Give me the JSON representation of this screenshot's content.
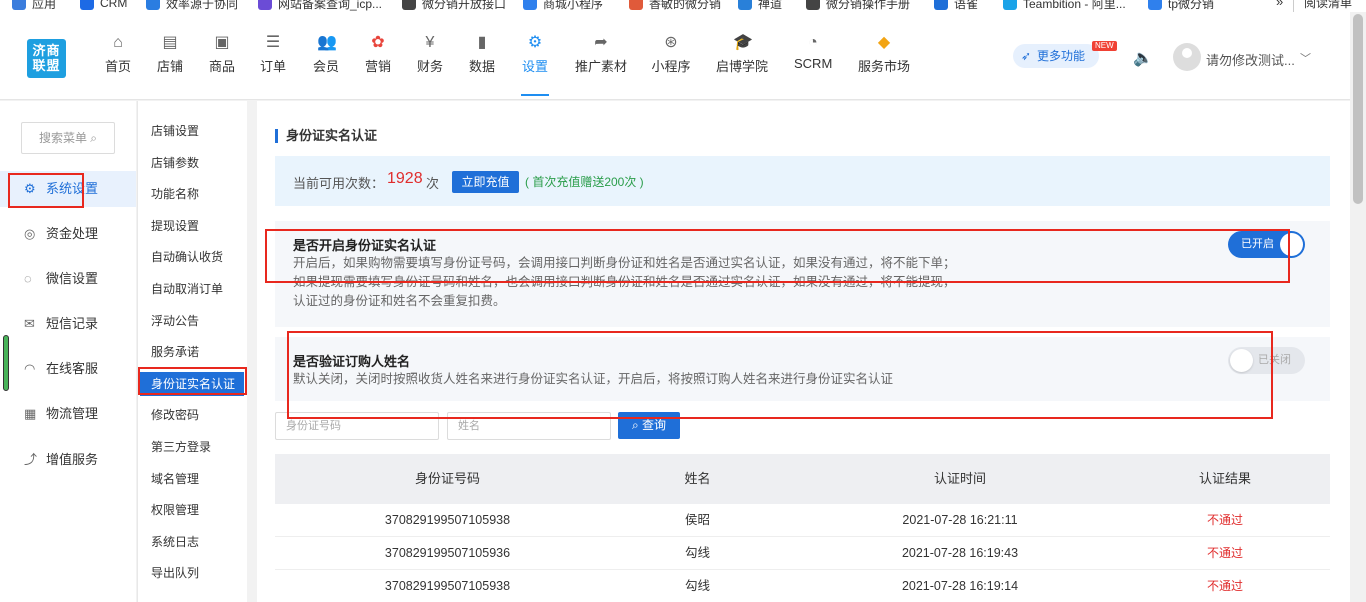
{
  "bookmarks": [
    {
      "label": "应用",
      "color": "#3b7ddd"
    },
    {
      "label": "CRM",
      "color": "#1d6ae5"
    },
    {
      "label": "效率源于协同",
      "color": "#2a7de1"
    },
    {
      "label": "网站备案查询_icp...",
      "color": "#6b4cd6"
    },
    {
      "label": "微分销开放接口",
      "color": "#444444"
    },
    {
      "label": "商城小程序",
      "color": "#2f80ed"
    },
    {
      "label": "香敏的微分销",
      "color": "#e05a3a"
    },
    {
      "label": "禅道",
      "color": "#2980d9"
    },
    {
      "label": "微分销操作手册",
      "color": "#444444"
    },
    {
      "label": "语雀",
      "color": "#1f6fd8"
    },
    {
      "label": "Teambition - 阿里...",
      "color": "#1aa3e8"
    },
    {
      "label": "tp微分销",
      "color": "#2f80ed"
    }
  ],
  "bookmarks_more": "»",
  "reading_list": "阅读清单",
  "logo_text": "济商联盟",
  "nav": [
    {
      "label": "首页",
      "icon": "home-icon",
      "glyph": "⌂"
    },
    {
      "label": "店铺",
      "icon": "shop-icon",
      "glyph": "▤"
    },
    {
      "label": "商品",
      "icon": "goods-icon",
      "glyph": "▣"
    },
    {
      "label": "订单",
      "icon": "order-icon",
      "glyph": "☰"
    },
    {
      "label": "会员",
      "icon": "member-icon",
      "glyph": "👥"
    },
    {
      "label": "营销",
      "icon": "marketing-icon",
      "glyph": "✿"
    },
    {
      "label": "财务",
      "icon": "finance-icon",
      "glyph": "¥"
    },
    {
      "label": "数据",
      "icon": "data-icon",
      "glyph": "▮"
    },
    {
      "label": "设置",
      "icon": "settings-icon",
      "glyph": "⚙"
    },
    {
      "label": "推广素材",
      "icon": "share-icon",
      "glyph": "➦"
    },
    {
      "label": "小程序",
      "icon": "miniapp-icon",
      "glyph": "⊛"
    },
    {
      "label": "启博学院",
      "icon": "academy-icon",
      "glyph": "🎓"
    },
    {
      "label": "SCRM",
      "icon": "scrm-icon",
      "glyph": "◔"
    },
    {
      "label": "服务市场",
      "icon": "market-icon",
      "glyph": "◆"
    }
  ],
  "more_functions": "更多功能",
  "new_badge": "NEW",
  "user_name": "请勿修改测试...",
  "side1": {
    "search": "搜索菜单 ⌕",
    "items": [
      {
        "label": "系统设置",
        "icon": "gear-icon",
        "glyph": "⚙"
      },
      {
        "label": "资金处理",
        "icon": "money-icon",
        "glyph": "◎"
      },
      {
        "label": "微信设置",
        "icon": "wechat-icon",
        "glyph": "◌"
      },
      {
        "label": "短信记录",
        "icon": "sms-icon",
        "glyph": "✉"
      },
      {
        "label": "在线客服",
        "icon": "headset-icon",
        "glyph": "◠"
      },
      {
        "label": "物流管理",
        "icon": "logistics-icon",
        "glyph": "▦"
      },
      {
        "label": "增值服务",
        "icon": "chart-icon",
        "glyph": "⤴"
      }
    ]
  },
  "side2": {
    "items": [
      "店铺设置",
      "店铺参数",
      "功能名称",
      "提现设置",
      "自动确认收货",
      "自动取消订单",
      "浮动公告",
      "服务承诺",
      "身份证实名认证",
      "修改密码",
      "第三方登录",
      "域名管理",
      "权限管理",
      "系统日志",
      "导出队列"
    ]
  },
  "main": {
    "title": "身份证实名认证",
    "quota_label": "当前可用次数：",
    "quota_value": "1928",
    "quota_unit": "次",
    "recharge_button": "立即充值",
    "gift_note": "( 首次充值赠送200次 )",
    "setting1": {
      "title": "是否开启身份证实名认证",
      "desc1": "开启后，如果购物需要填写身份证号码，会调用接口判断身份证和姓名是否通过实名认证，如果没有通过，将不能下单；",
      "desc2": "如果提现需要填写身份证号码和姓名，也会调用接口判断身份证和姓名是否通过实名认证，如果没有通过，将不能提现，",
      "desc3": "认证过的身份证和姓名不会重复扣费。",
      "toggle": "已开启",
      "enabled": true
    },
    "setting2": {
      "title": "是否验证订购人姓名",
      "desc1": "默认关闭，关闭时按照收货人姓名来进行身份证实名认证，开启后，将按照订购人姓名来进行身份证实名认证",
      "toggle": "已关闭",
      "enabled": false
    },
    "id_placeholder": "身份证号码",
    "name_placeholder": "姓名",
    "query_button": "查询",
    "table": {
      "headers": [
        "身份证号码",
        "姓名",
        "认证时间",
        "认证结果"
      ],
      "rows": [
        [
          "370829199507105938",
          "侯昭",
          "2021-07-28 16:21:11",
          "不通过"
        ],
        [
          "370829199507105936",
          "勾线",
          "2021-07-28 16:19:43",
          "不通过"
        ],
        [
          "370829199507105938",
          "勾线",
          "2021-07-28 16:19:14",
          "不通过"
        ]
      ]
    }
  }
}
